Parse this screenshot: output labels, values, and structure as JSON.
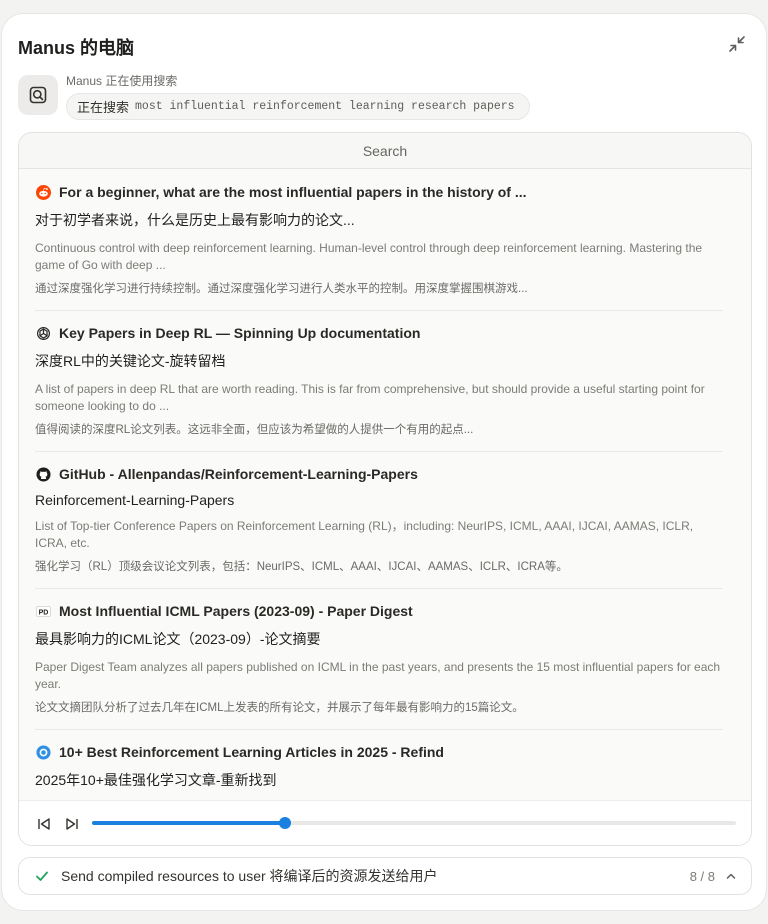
{
  "window": {
    "title": "Manus 的电脑"
  },
  "tool": {
    "status": "Manus 正在使用搜索",
    "action": "正在搜索",
    "query": "most influential reinforcement learning research papers"
  },
  "viewer": {
    "tab_label": "Search",
    "results": [
      {
        "icon": "reddit-icon",
        "title": "For a beginner, what are the most influential papers in the history of ...",
        "title_zh": "对于初学者来说，什么是历史上最有影响力的论文...",
        "snippet": "Continuous control with deep reinforcement learning. Human-level control through deep reinforcement learning. Mastering the game of Go with deep ...",
        "snippet_zh": "通过深度强化学习进行持续控制。通过深度强化学习进行人类水平的控制。用深度掌握围棋游戏..."
      },
      {
        "icon": "openai-icon",
        "title": "Key Papers in Deep RL — Spinning Up documentation",
        "title_zh": "深度RL中的关键论文-旋转留档",
        "snippet": "A list of papers in deep RL that are worth reading. This is far from comprehensive, but should provide a useful starting point for someone looking to do ...",
        "snippet_zh": "值得阅读的深度RL论文列表。这远非全面，但应该为希望做的人提供一个有用的起点..."
      },
      {
        "icon": "github-icon",
        "title": "GitHub - Allenpandas/Reinforcement-Learning-Papers",
        "title_zh": "Reinforcement-Learning-Papers",
        "snippet": "List of Top-tier Conference Papers on Reinforcement Learning (RL)，including: NeurIPS, ICML, AAAI, IJCAI, AAMAS, ICLR, ICRA, etc.",
        "snippet_zh": "强化学习（RL）顶级会议论文列表，包括：NeurIPS、ICML、AAAI、IJCAI、AAMAS、ICLR、ICRA等。"
      },
      {
        "icon": "paper-digest-icon",
        "title": "Most Influential ICML Papers (2023-09) - Paper Digest",
        "title_zh": "最具影响力的ICML论文（2023-09）-论文摘要",
        "snippet": "Paper Digest Team analyzes all papers published on ICML in the past years, and presents the 15 most influential papers for each year.",
        "snippet_zh": "论文文摘团队分析了过去几年在ICML上发表的所有论文，并展示了每年最有影响力的15篇论文。"
      },
      {
        "icon": "refind-icon",
        "title": "10+ Best Reinforcement Learning Articles in 2025 - Refind",
        "title_zh": "2025年10+最佳强化学习文章-重新找到",
        "snippet": "",
        "snippet_zh": ""
      }
    ],
    "progress": 0.3,
    "accent_color": "#1a81e0"
  },
  "step": {
    "text": "Send compiled resources to user 将编译后的资源发送给用户",
    "count": "8 / 8",
    "status_color": "#22a45d"
  }
}
